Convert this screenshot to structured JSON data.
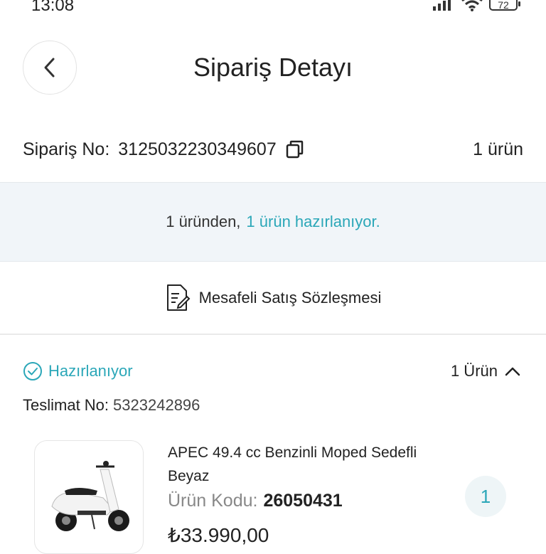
{
  "status_bar": {
    "time": "13:08",
    "battery": "72"
  },
  "header": {
    "title": "Sipariş Detayı"
  },
  "order": {
    "number_label": "Sipariş No:",
    "number_value": "3125032230349607",
    "item_count": "1 ürün"
  },
  "banner": {
    "text": "1 üründen,",
    "highlight": "1 ürün hazırlanıyor."
  },
  "contract": {
    "label": "Mesafeli Satış Sözleşmesi"
  },
  "shipment": {
    "status": "Hazırlanıyor",
    "count_label": "1 Ürün",
    "delivery_label": "Teslimat No:",
    "delivery_value": "5323242896"
  },
  "product": {
    "name": "APEC 49.4 cc Benzinli Moped Sedefli Beyaz",
    "code_label": "Ürün Kodu:",
    "code_value": "26050431",
    "price": "₺33.990,00",
    "quantity": "1"
  },
  "colors": {
    "accent": "#2ba7b8",
    "banner_bg": "#f1f5f9",
    "text": "#222222"
  },
  "icons": {
    "back": "chevron-left-icon",
    "copy": "copy-icon",
    "contract": "document-edit-icon",
    "status": "check-circle-icon",
    "collapse": "chevron-up-icon"
  }
}
